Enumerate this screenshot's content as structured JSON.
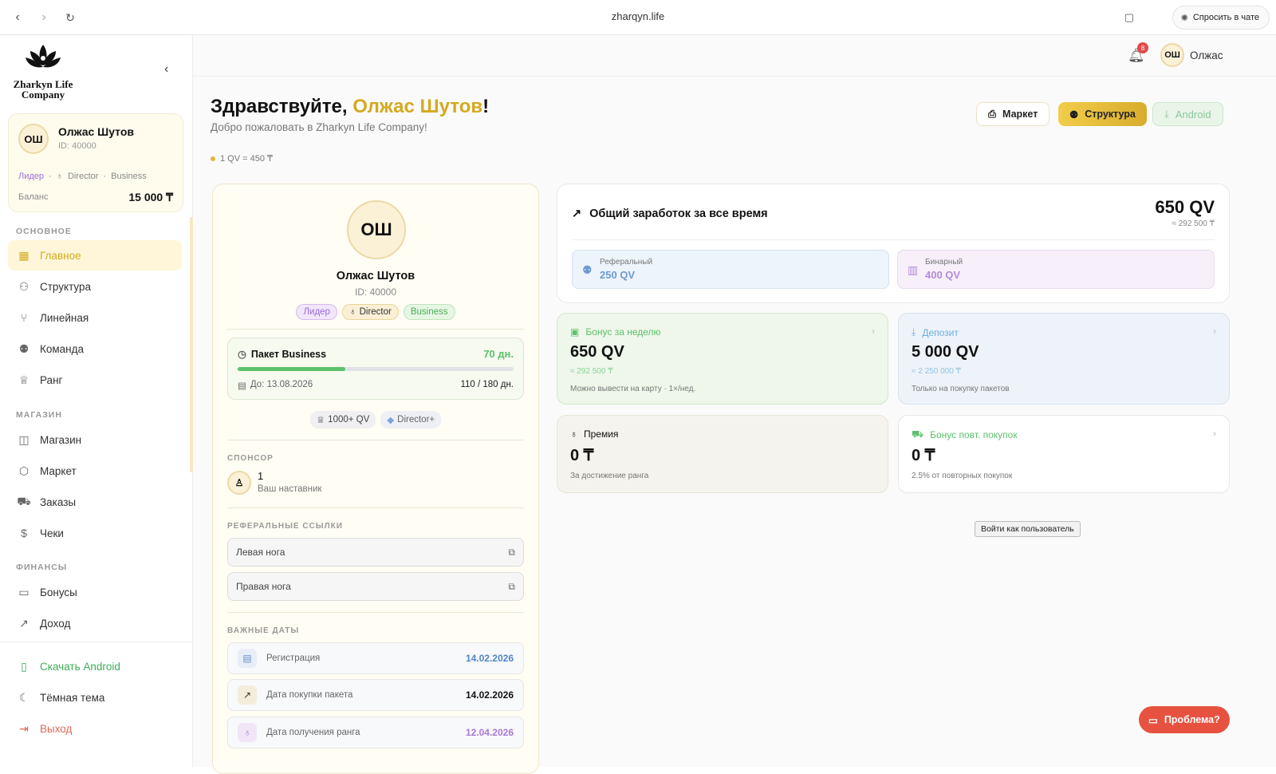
{
  "browser": {
    "url": "zharqyn.life",
    "ask_chat": "Спросить в чате"
  },
  "sidebar": {
    "logo_line1": "Zharkyn Life",
    "logo_line2": "Company",
    "profile": {
      "initials": "ОШ",
      "name": "Олжас Шутов",
      "id": "ID: 40000",
      "role": "Лидер",
      "rank": "Director",
      "package": "Business",
      "balance_label": "Баланс",
      "balance_value": "15 000 ₸"
    },
    "sections": {
      "main": "ОСНОВНОЕ",
      "shop": "МАГАЗИН",
      "finance": "ФИНАНСЫ"
    },
    "items": {
      "home": "Главное",
      "structure": "Структура",
      "linear": "Линейная",
      "team": "Команда",
      "rank": "Ранг",
      "shop": "Магазин",
      "market": "Маркет",
      "orders": "Заказы",
      "receipts": "Чеки",
      "bonuses": "Бонусы",
      "income": "Доход"
    },
    "bottom": {
      "android": "Скачать Android",
      "theme": "Тёмная тема",
      "logout": "Выход"
    }
  },
  "topbar": {
    "notifications": "8",
    "initials": "ОШ",
    "user": "Олжас"
  },
  "header": {
    "hello": "Здравствуйте, ",
    "name": "Олжас Шутов",
    "excl": "!",
    "welcome": "Добро пожаловать в Zharkyn Life Company!",
    "rate": "1 QV = 450 ₸"
  },
  "actions": {
    "market": "Маркет",
    "structure": "Структура",
    "android": "Android"
  },
  "profile": {
    "initials": "ОШ",
    "name": "Олжас Шутов",
    "id": "ID: 40000",
    "role": "Лидер",
    "rank": "Director",
    "package": "Business",
    "pkg_title": "Пакет Business",
    "pkg_days": "70 дн.",
    "pkg_progress": 0.39,
    "pkg_until": "До: 13.08.2026",
    "pkg_count": "110 / 180 дн.",
    "goal1": "1000+ QV",
    "goal2": "Director+",
    "sponsor_label": "СПОНСОР",
    "sponsor_name": "1",
    "sponsor_sub": "Ваш наставник",
    "ref_label": "РЕФЕРАЛЬНЫЕ ССЫЛКИ",
    "ref_left": "Левая нога",
    "ref_right": "Правая нога",
    "dates_label": "ВАЖНЫЕ ДАТЫ",
    "date_reg_label": "Регистрация",
    "date_reg": "14.02.2026",
    "date_pkg_label": "Дата покупки пакета",
    "date_pkg": "14.02.2026",
    "date_rank_label": "Дата получения ранга",
    "date_rank": "12.04.2026"
  },
  "earnings": {
    "title": "Общий заработок за все время",
    "total": "650 QV",
    "total_tg": "≈ 292 500 ₸",
    "ref_label": "Реферальный",
    "ref_value": "250 QV",
    "bin_label": "Бинарный",
    "bin_value": "400 QV"
  },
  "cards": {
    "weekly": {
      "title": "Бонус за неделю",
      "value": "650 QV",
      "tg": "≈ 292 500 ₸",
      "note": "Можно вывести на карту · 1×/нед."
    },
    "deposit": {
      "title": "Депозит",
      "value": "5 000 QV",
      "tg": "≈ 2 250 000 ₸",
      "note": "Только на покупку пакетов"
    },
    "premium": {
      "title": "Премия",
      "value": "0 ₸",
      "note": "За достижение ранга"
    },
    "repeat": {
      "title": "Бонус повт. покупок",
      "value": "0 ₸",
      "note": "2.5% от повторных покупок"
    }
  },
  "tooltip": "Войти как пользователь",
  "problem": "Проблема?"
}
